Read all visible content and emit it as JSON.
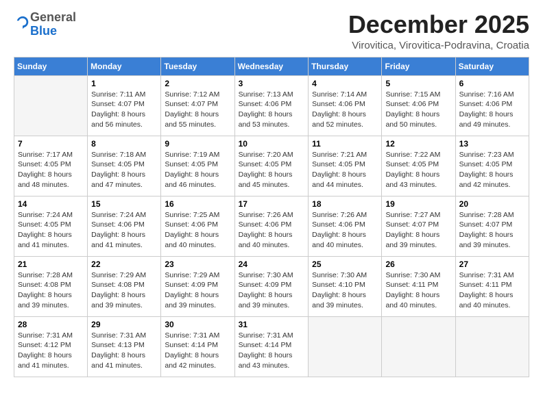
{
  "logo": {
    "general": "General",
    "blue": "Blue"
  },
  "header": {
    "month": "December 2025",
    "location": "Virovitica, Virovitica-Podravina, Croatia"
  },
  "weekdays": [
    "Sunday",
    "Monday",
    "Tuesday",
    "Wednesday",
    "Thursday",
    "Friday",
    "Saturday"
  ],
  "weeks": [
    [
      {
        "day": "",
        "info": ""
      },
      {
        "day": "1",
        "info": "Sunrise: 7:11 AM\nSunset: 4:07 PM\nDaylight: 8 hours\nand 56 minutes."
      },
      {
        "day": "2",
        "info": "Sunrise: 7:12 AM\nSunset: 4:07 PM\nDaylight: 8 hours\nand 55 minutes."
      },
      {
        "day": "3",
        "info": "Sunrise: 7:13 AM\nSunset: 4:06 PM\nDaylight: 8 hours\nand 53 minutes."
      },
      {
        "day": "4",
        "info": "Sunrise: 7:14 AM\nSunset: 4:06 PM\nDaylight: 8 hours\nand 52 minutes."
      },
      {
        "day": "5",
        "info": "Sunrise: 7:15 AM\nSunset: 4:06 PM\nDaylight: 8 hours\nand 50 minutes."
      },
      {
        "day": "6",
        "info": "Sunrise: 7:16 AM\nSunset: 4:06 PM\nDaylight: 8 hours\nand 49 minutes."
      }
    ],
    [
      {
        "day": "7",
        "info": "Sunrise: 7:17 AM\nSunset: 4:05 PM\nDaylight: 8 hours\nand 48 minutes."
      },
      {
        "day": "8",
        "info": "Sunrise: 7:18 AM\nSunset: 4:05 PM\nDaylight: 8 hours\nand 47 minutes."
      },
      {
        "day": "9",
        "info": "Sunrise: 7:19 AM\nSunset: 4:05 PM\nDaylight: 8 hours\nand 46 minutes."
      },
      {
        "day": "10",
        "info": "Sunrise: 7:20 AM\nSunset: 4:05 PM\nDaylight: 8 hours\nand 45 minutes."
      },
      {
        "day": "11",
        "info": "Sunrise: 7:21 AM\nSunset: 4:05 PM\nDaylight: 8 hours\nand 44 minutes."
      },
      {
        "day": "12",
        "info": "Sunrise: 7:22 AM\nSunset: 4:05 PM\nDaylight: 8 hours\nand 43 minutes."
      },
      {
        "day": "13",
        "info": "Sunrise: 7:23 AM\nSunset: 4:05 PM\nDaylight: 8 hours\nand 42 minutes."
      }
    ],
    [
      {
        "day": "14",
        "info": "Sunrise: 7:24 AM\nSunset: 4:05 PM\nDaylight: 8 hours\nand 41 minutes."
      },
      {
        "day": "15",
        "info": "Sunrise: 7:24 AM\nSunset: 4:06 PM\nDaylight: 8 hours\nand 41 minutes."
      },
      {
        "day": "16",
        "info": "Sunrise: 7:25 AM\nSunset: 4:06 PM\nDaylight: 8 hours\nand 40 minutes."
      },
      {
        "day": "17",
        "info": "Sunrise: 7:26 AM\nSunset: 4:06 PM\nDaylight: 8 hours\nand 40 minutes."
      },
      {
        "day": "18",
        "info": "Sunrise: 7:26 AM\nSunset: 4:06 PM\nDaylight: 8 hours\nand 40 minutes."
      },
      {
        "day": "19",
        "info": "Sunrise: 7:27 AM\nSunset: 4:07 PM\nDaylight: 8 hours\nand 39 minutes."
      },
      {
        "day": "20",
        "info": "Sunrise: 7:28 AM\nSunset: 4:07 PM\nDaylight: 8 hours\nand 39 minutes."
      }
    ],
    [
      {
        "day": "21",
        "info": "Sunrise: 7:28 AM\nSunset: 4:08 PM\nDaylight: 8 hours\nand 39 minutes."
      },
      {
        "day": "22",
        "info": "Sunrise: 7:29 AM\nSunset: 4:08 PM\nDaylight: 8 hours\nand 39 minutes."
      },
      {
        "day": "23",
        "info": "Sunrise: 7:29 AM\nSunset: 4:09 PM\nDaylight: 8 hours\nand 39 minutes."
      },
      {
        "day": "24",
        "info": "Sunrise: 7:30 AM\nSunset: 4:09 PM\nDaylight: 8 hours\nand 39 minutes."
      },
      {
        "day": "25",
        "info": "Sunrise: 7:30 AM\nSunset: 4:10 PM\nDaylight: 8 hours\nand 39 minutes."
      },
      {
        "day": "26",
        "info": "Sunrise: 7:30 AM\nSunset: 4:11 PM\nDaylight: 8 hours\nand 40 minutes."
      },
      {
        "day": "27",
        "info": "Sunrise: 7:31 AM\nSunset: 4:11 PM\nDaylight: 8 hours\nand 40 minutes."
      }
    ],
    [
      {
        "day": "28",
        "info": "Sunrise: 7:31 AM\nSunset: 4:12 PM\nDaylight: 8 hours\nand 41 minutes."
      },
      {
        "day": "29",
        "info": "Sunrise: 7:31 AM\nSunset: 4:13 PM\nDaylight: 8 hours\nand 41 minutes."
      },
      {
        "day": "30",
        "info": "Sunrise: 7:31 AM\nSunset: 4:14 PM\nDaylight: 8 hours\nand 42 minutes."
      },
      {
        "day": "31",
        "info": "Sunrise: 7:31 AM\nSunset: 4:14 PM\nDaylight: 8 hours\nand 43 minutes."
      },
      {
        "day": "",
        "info": ""
      },
      {
        "day": "",
        "info": ""
      },
      {
        "day": "",
        "info": ""
      }
    ]
  ]
}
